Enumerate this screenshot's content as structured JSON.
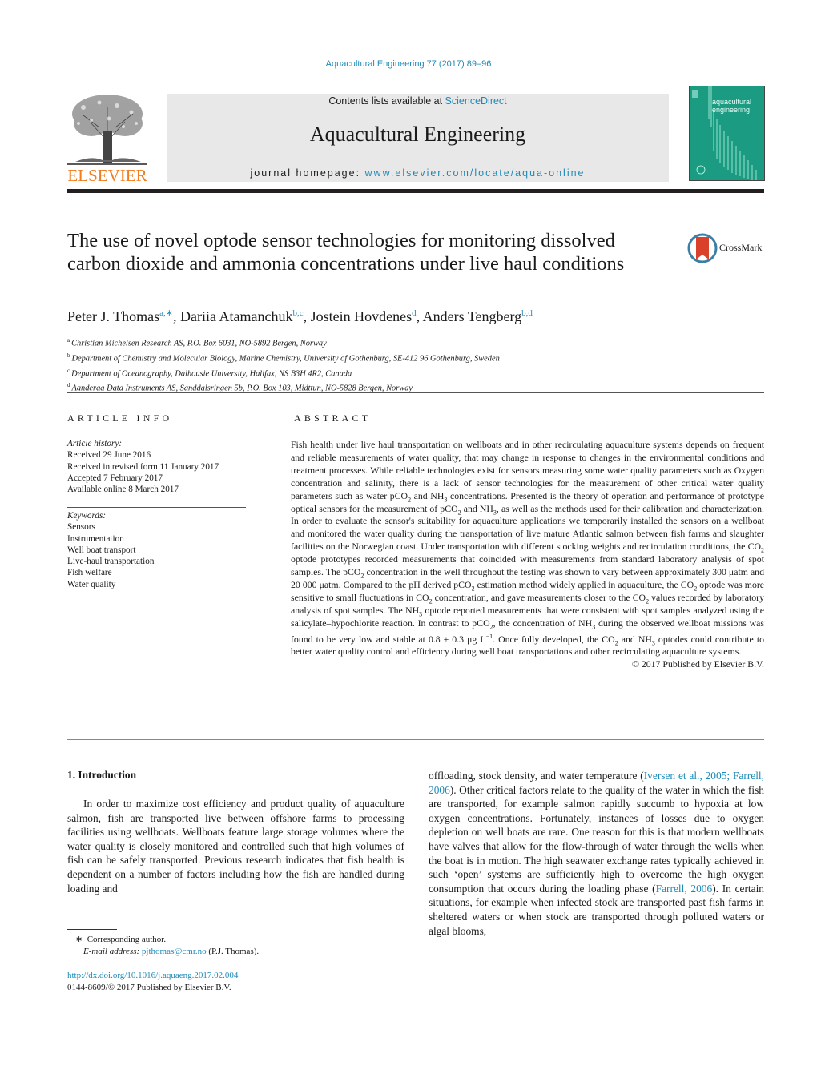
{
  "header": {
    "citation": "Aquacultural Engineering 77 (2017) 89–96",
    "publisher_logo": "ELSEVIER",
    "contents_prefix": "Contents lists available at ",
    "contents_link": "ScienceDirect",
    "journal_name": "Aquacultural Engineering",
    "homepage_prefix": "journal homepage: ",
    "homepage_link": "www.elsevier.com/locate/aqua-online",
    "cover_title_line1": "aquacultural",
    "cover_title_line2": "engineering",
    "colors": {
      "link": "#1e8ab8",
      "elsevier_orange": "#f07d1f",
      "cover_teal": "#1b9b82"
    }
  },
  "article": {
    "title": "The use of novel optode sensor technologies for monitoring dissolved carbon dioxide and ammonia concentrations under live haul conditions",
    "crossmark_label": "CrossMark",
    "authors": [
      {
        "name": "Peter J. Thomas",
        "sup": "a,∗"
      },
      {
        "name": "Dariia Atamanchuk",
        "sup": "b,c"
      },
      {
        "name": "Jostein Hovdenes",
        "sup": "d"
      },
      {
        "name": "Anders Tengberg",
        "sup": "b,d"
      }
    ],
    "affiliations": [
      {
        "key": "a",
        "text": "Christian Michelsen Research AS, P.O. Box 6031, NO-5892 Bergen, Norway"
      },
      {
        "key": "b",
        "text": "Department of Chemistry and Molecular Biology, Marine Chemistry, University of Gothenburg, SE-412 96 Gothenburg, Sweden"
      },
      {
        "key": "c",
        "text": "Department of Oceanography, Dalhousie University, Halifax, NS B3H 4R2, Canada"
      },
      {
        "key": "d",
        "text": "Aanderaa Data Instruments AS, Sanddalsringen 5b, P.O. Box 103, Midttun, NO-5828 Bergen, Norway"
      }
    ]
  },
  "article_info": {
    "heading": "ARTICLE INFO",
    "history_label": "Article history:",
    "history": [
      "Received 29 June 2016",
      "Received in revised form 11 January 2017",
      "Accepted 7 February 2017",
      "Available online 8 March 2017"
    ],
    "keywords_label": "Keywords:",
    "keywords": [
      "Sensors",
      "Instrumentation",
      "Well boat transport",
      "Live-haul transportation",
      "Fish welfare",
      "Water quality"
    ]
  },
  "abstract": {
    "heading": "ABSTRACT",
    "segments": [
      "Fish health under live haul transportation on wellboats and in other recirculating aquaculture systems depends on frequent and reliable measurements of water quality, that may change in response to changes in the environmental conditions and treatment processes. While reliable technologies exist for sensors measuring some water quality parameters such as Oxygen concentration and salinity, there is a lack of sensor technologies for the measurement of other critical water quality parameters such as water pCO",
      "2",
      " and NH",
      "3",
      " concentrations. Presented is the theory of operation and performance of prototype optical sensors for the measurement of pCO",
      "2",
      " and NH",
      "3",
      ", as well as the methods used for their calibration and characterization. In order to evaluate the sensor's suitability for aquaculture applications we temporarily installed the sensors on a wellboat and monitored the water quality during the transportation of live mature Atlantic salmon between fish farms and slaughter facilities on the Norwegian coast. Under transportation with different stocking weights and recirculation conditions, the CO",
      "2",
      " optode prototypes recorded measurements that coincided with measurements from standard laboratory analysis of spot samples. The pCO",
      "2",
      " concentration in the well throughout the testing was shown to vary between approximately 300 μatm and 20 000 μatm. Compared to the pH derived pCO",
      "2",
      " estimation method widely applied in aquaculture, the CO",
      "2",
      " optode was more sensitive to small fluctuations in CO",
      "2",
      " concentration, and gave measurements closer to the CO",
      "2",
      " values recorded by laboratory analysis of spot samples. The NH",
      "3",
      " optode reported measurements that were consistent with spot samples analyzed using the salicylate–hypochlorite reaction. In contrast to pCO",
      "2",
      ", the concentration of NH",
      "3",
      " during the observed wellboat missions was found to be very low and stable at 0.8 ± 0.3 μg L",
      "−1",
      ". Once fully developed, the CO",
      "2",
      " and NH",
      "3",
      " optodes could contribute to better water quality control and efficiency during well boat transportations and other recirculating aquaculture systems."
    ],
    "copyright": "© 2017 Published by Elsevier B.V."
  },
  "introduction": {
    "heading": "1.  Introduction",
    "left_text": "In order to maximize cost efficiency and product quality of aquaculture salmon, fish are transported live between offshore farms to processing facilities using wellboats. Wellboats feature large storage volumes where the water quality is closely monitored and controlled such that high volumes of fish can be safely transported. Previous research indicates that fish health is dependent on a number of factors including how the fish are handled during loading and",
    "right_text_1": "offloading, stock density, and water temperature (",
    "ref_1": "Iversen et al., 2005; Farrell, 2006",
    "right_text_2": "). Other critical factors relate to the quality of the water in which the fish are transported, for example salmon rapidly succumb to hypoxia at low oxygen concentrations. Fortunately, instances of losses due to oxygen depletion on well boats are rare. One reason for this is that modern wellboats have valves that allow for the flow-through of water through the wells when the boat is in motion. The high seawater exchange rates typically achieved in such ‘open’ systems are sufficiently high to overcome the high oxygen consumption that occurs during the loading phase (",
    "ref_2": "Farrell, 2006",
    "right_text_3": "). In certain situations, for example when infected stock are transported past fish farms in sheltered waters or when stock are transported through polluted waters or algal blooms,"
  },
  "footer": {
    "corresponding_mark": "∗",
    "corresponding_text": "Corresponding author.",
    "email_label": "E-mail address:",
    "email": "pjthomas@cmr.no",
    "email_suffix": "(P.J. Thomas).",
    "doi": "http://dx.doi.org/10.1016/j.aquaeng.2017.02.004",
    "issn_line": "0144-8609/© 2017 Published by Elsevier B.V."
  }
}
